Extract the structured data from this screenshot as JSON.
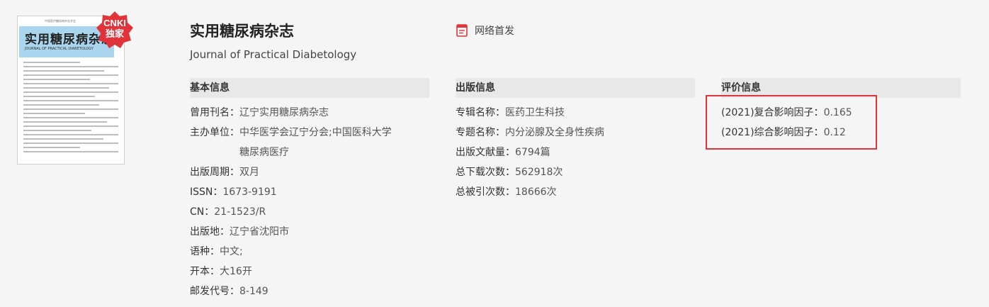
{
  "cover": {
    "top_text": "中国医疗糖尿病杂志学会",
    "title": "实用糖尿病杂志",
    "subtitle": "JOURNAL OF PRACTICAL DIABETOLOGY",
    "badge_line1": "CNKI",
    "badge_line2": "独家",
    "badge_color": "#e0343a"
  },
  "journal": {
    "title_cn": "实用糖尿病杂志",
    "title_en": "Journal of Practical Diabetology"
  },
  "online_first": {
    "label": "网络首发",
    "icon": "document-icon"
  },
  "basic_info": {
    "heading": "基本信息",
    "rows": [
      {
        "label": "曾用刊名：",
        "value": "辽宁实用糖尿病杂志"
      },
      {
        "label": "主办单位：",
        "value": "中华医学会辽宁分会;中国医科大学糖尿病医疗"
      },
      {
        "label": "出版周期：",
        "value": "双月"
      },
      {
        "label": "ISSN：",
        "value": "1673-9191"
      },
      {
        "label": "CN：",
        "value": "21-1523/R"
      },
      {
        "label": "出版地：",
        "value": "辽宁省沈阳市"
      },
      {
        "label": "语种：",
        "value": "中文;"
      },
      {
        "label": "开本：",
        "value": "大16开"
      },
      {
        "label": "邮发代号：",
        "value": "8-149"
      }
    ]
  },
  "pub_info": {
    "heading": "出版信息",
    "rows": [
      {
        "label": "专辑名称：",
        "value": "医药卫生科技"
      },
      {
        "label": "专题名称：",
        "value": "内分泌腺及全身性疾病"
      },
      {
        "label": "出版文献量：",
        "value": "6794篇"
      },
      {
        "label": "总下载次数：",
        "value": "562918次"
      },
      {
        "label": "总被引次数：",
        "value": "18666次"
      }
    ]
  },
  "eval_info": {
    "heading": "评价信息",
    "rows": [
      {
        "label": "(2021)复合影响因子：",
        "value": "0.165"
      },
      {
        "label": "(2021)综合影响因子：",
        "value": "0.12"
      }
    ],
    "highlight_color": "#e0343a"
  }
}
